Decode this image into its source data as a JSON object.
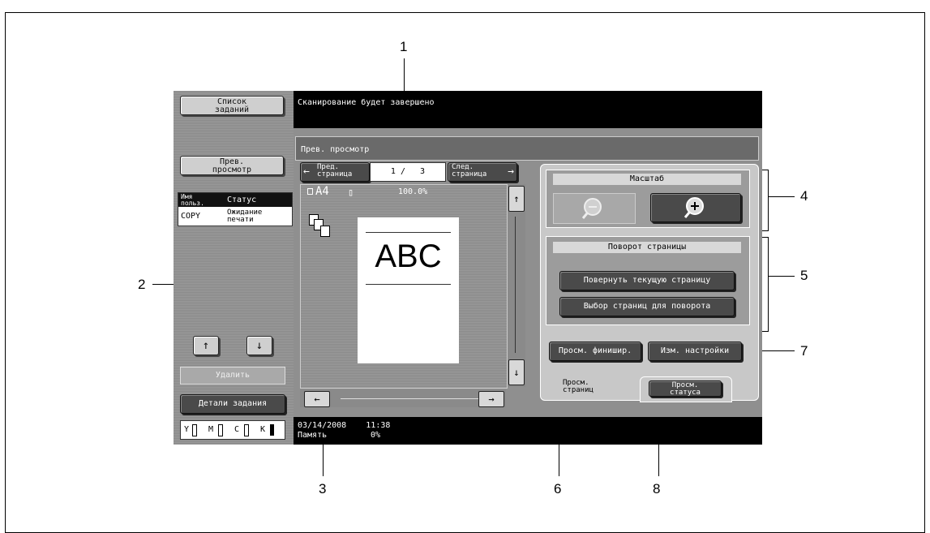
{
  "callouts": [
    "1",
    "2",
    "3",
    "4",
    "5",
    "6",
    "7",
    "8"
  ],
  "left_panel": {
    "job_list_button": "Список\nзаданий",
    "preview_button": "Прев.\nпросмотр",
    "table_header_user": "Имя\nпольз.",
    "table_header_status": "Статус",
    "row_user": "COPY",
    "row_status": "Ожидание\nпечати",
    "up_arrow": "↑",
    "down_arrow": "↓",
    "delete_button": "Удалить",
    "job_details_button": "Детали задания",
    "toner": [
      "Y",
      "M",
      "C",
      "K"
    ]
  },
  "top_message": "Сканирование будет завершено",
  "preview": {
    "title": "Прев. просмотр",
    "prev_page_button": "Пред.\nстраница",
    "page_counter": "1 /   3",
    "next_page_button": "След.\nстраница",
    "paper_size": "A4",
    "zoom_percent": "100.0%",
    "page_text": "ABC",
    "scroll_up": "↑",
    "scroll_down": "↓",
    "scroll_left": "←",
    "scroll_right": "→"
  },
  "right_panel": {
    "zoom_title": "Масштаб",
    "zoom_out_icon": "magnifier-minus",
    "zoom_in_icon": "magnifier-plus",
    "rotate_title": "Поворот страницы",
    "rotate_current_button": "Повернуть текущую страницу",
    "rotate_select_button": "Выбор страниц для поворота",
    "view_finishing_button": "Просм. финишир.",
    "change_settings_button": "Изм. настройки",
    "tab_view_pages": "Просм.\nстраниц",
    "tab_view_status": "Просм.\nстатуса"
  },
  "status_bar": {
    "datetime": "03/14/2008    11:38",
    "memory_label": "Память",
    "memory_value": "0%"
  }
}
